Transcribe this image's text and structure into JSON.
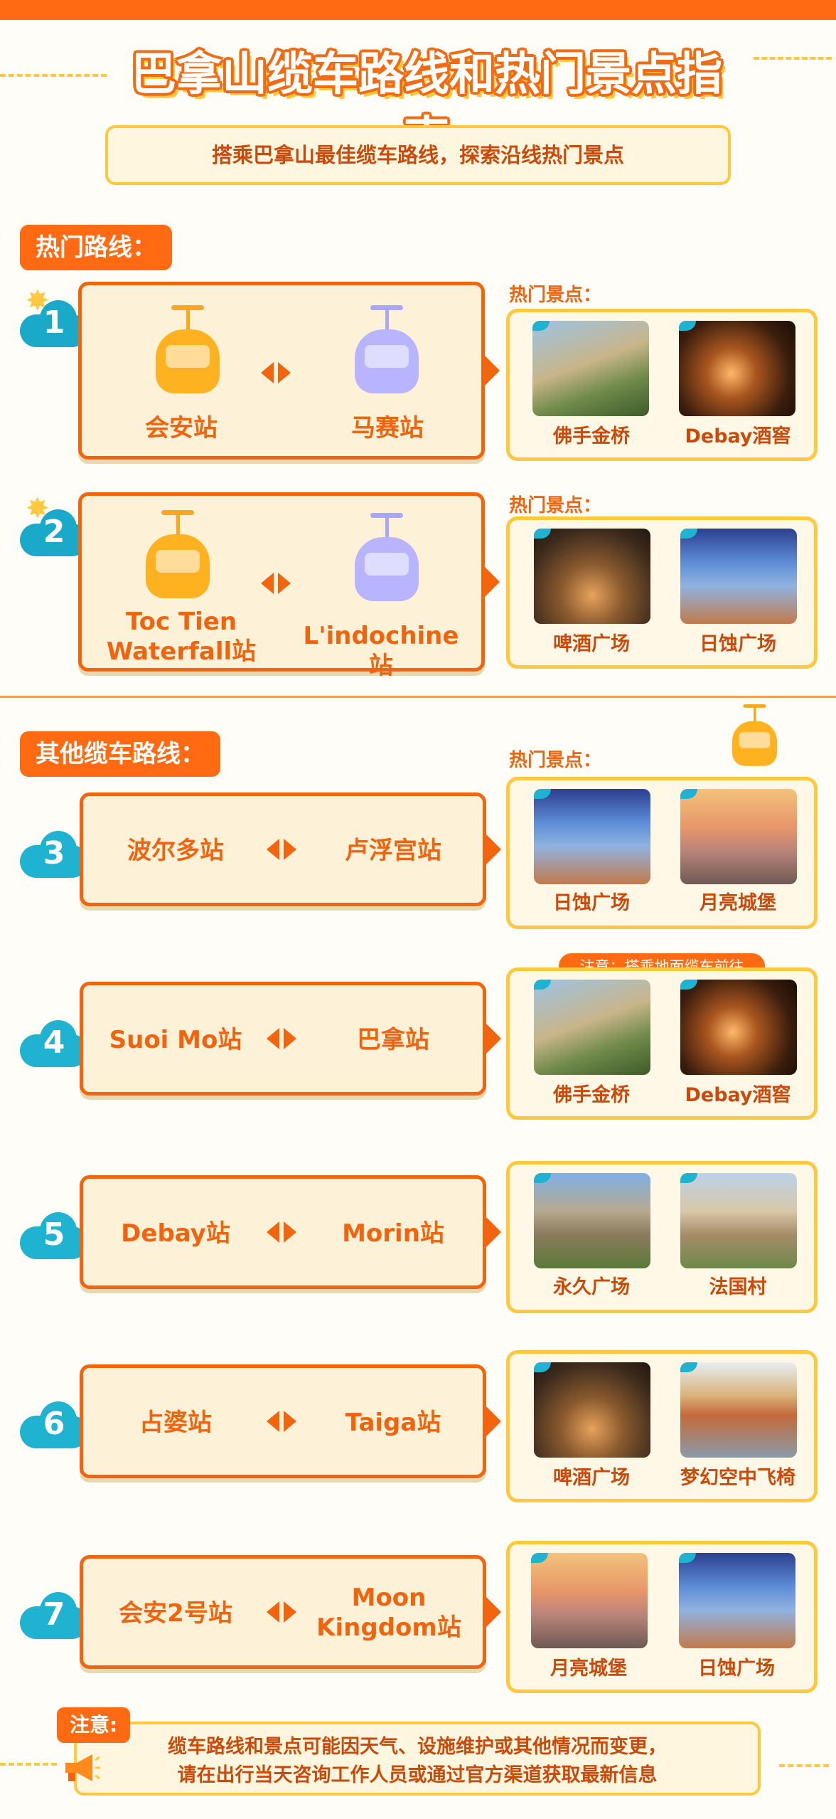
{
  "header": {
    "title": "巴拿山缆车路线和热门景点指南",
    "subtitle": "搭乘巴拿山最佳缆车路线，探索沿线热门景点"
  },
  "sections": {
    "hot_routes_label": "热门路线：",
    "other_routes_label": "其他缆车路线："
  },
  "spots_label": "热门景点：",
  "notice_ground": "注意：搭乘地面缆车前往",
  "routes": [
    {
      "num": "1",
      "from": "会安站",
      "to": "马赛站",
      "spots": [
        "佛手金桥",
        "Debay酒窖"
      ]
    },
    {
      "num": "2",
      "from_line1": "Toc Tien",
      "from_line2": "Waterfall站",
      "to": "L'indochine站",
      "spots": [
        "啤酒广场",
        "日蚀广场"
      ]
    },
    {
      "num": "3",
      "from": "波尔多站",
      "to": "卢浮宫站",
      "spots": [
        "日蚀广场",
        "月亮城堡"
      ]
    },
    {
      "num": "4",
      "from": "Suoi Mo站",
      "to": "巴拿站",
      "spots": [
        "佛手金桥",
        "Debay酒窖"
      ]
    },
    {
      "num": "5",
      "from": "Debay站",
      "to": "Morin站",
      "spots": [
        "永久广场",
        "法国村"
      ]
    },
    {
      "num": "6",
      "from": "占婆站",
      "to": "Taiga站",
      "spots": [
        "啤酒广场",
        "梦幻空中飞椅"
      ]
    },
    {
      "num": "7",
      "from": "会安2号站",
      "to_line1": "Moon",
      "to_line2": "Kingdom站",
      "spots": [
        "月亮城堡",
        "日蚀广场"
      ]
    }
  ],
  "footer": {
    "tag": "注意:",
    "line1": "缆车路线和景点可能因天气、设施维护或其他情况而变更，",
    "line2": "请在出行当天咨询工作人员或通过官方渠道获取最新信息"
  },
  "colors": {
    "primary": "#f2650e",
    "accent_yellow": "#ffc83d",
    "cloud_blue": "#20b3d1",
    "box_fill": "#fdf1d8"
  }
}
